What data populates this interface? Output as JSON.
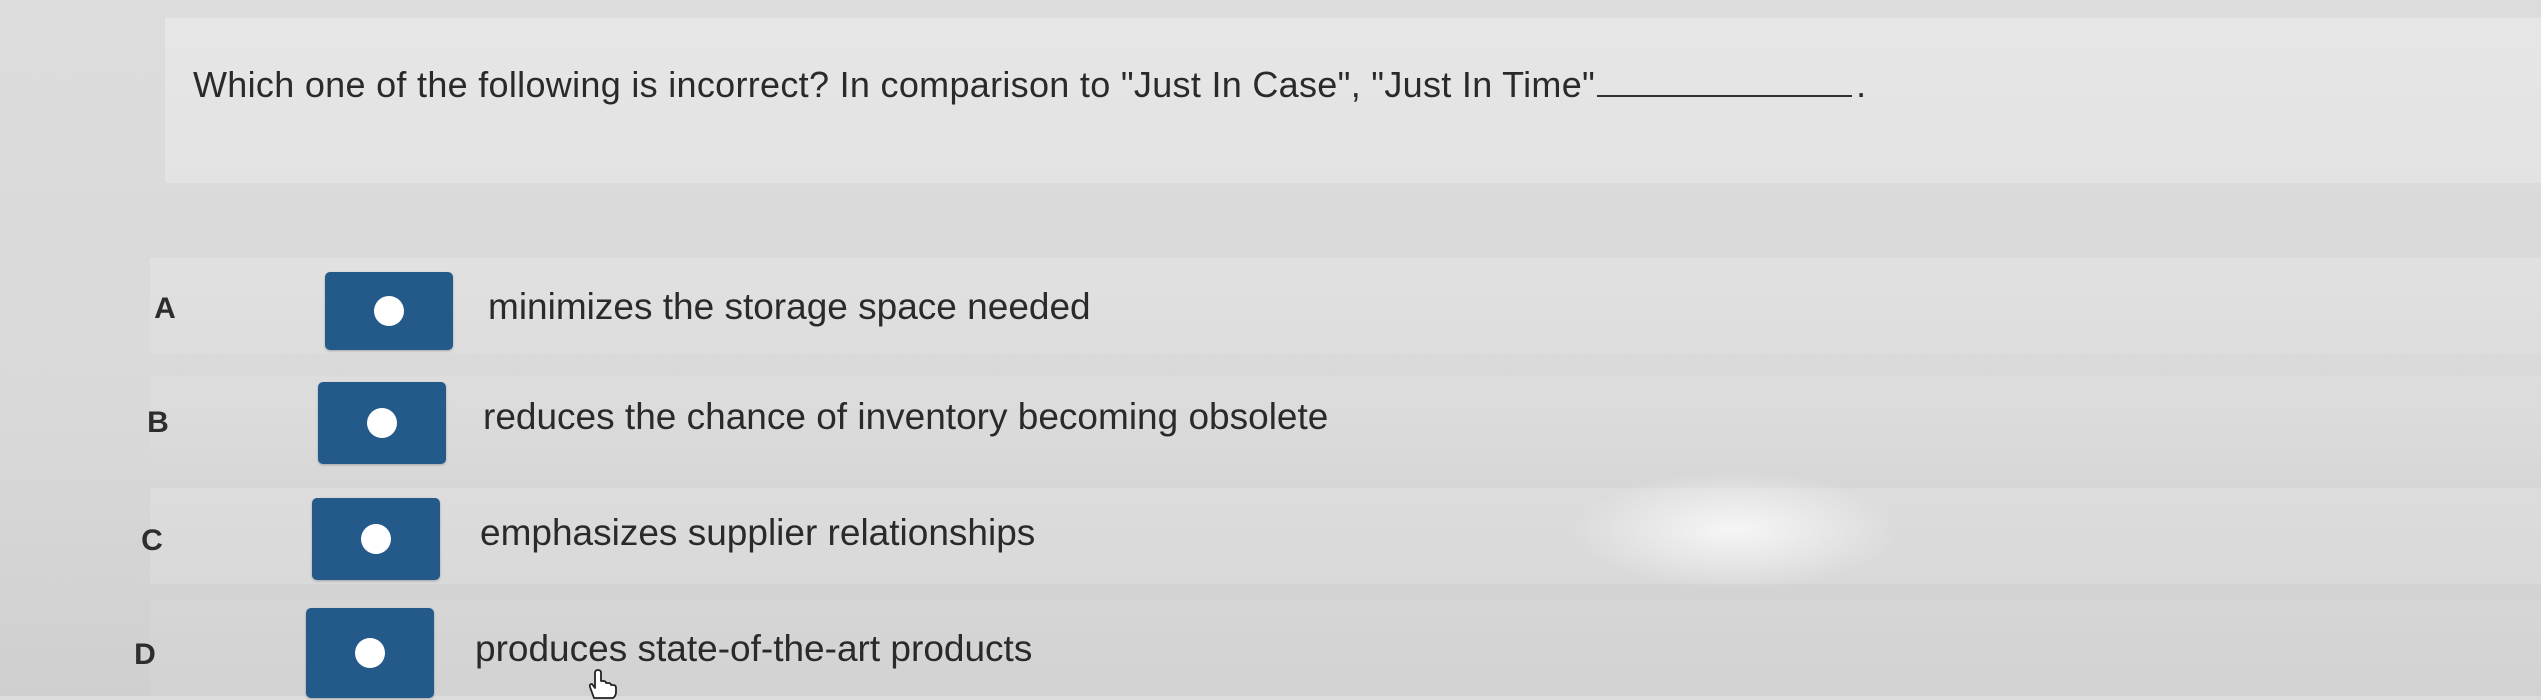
{
  "question": {
    "text": "Which one of the following is incorrect? In comparison to \"Just In Case\", \"Just In Time\"",
    "period": "."
  },
  "choices": [
    {
      "letter": "A",
      "text": "minimizes the storage space needed"
    },
    {
      "letter": "B",
      "text": "reduces the chance of inventory becoming obsolete"
    },
    {
      "letter": "C",
      "text": "emphasizes supplier relationships"
    },
    {
      "letter": "D",
      "text": "produces state-of-the-art products"
    }
  ],
  "colors": {
    "radio_button_fill": "#245a8a",
    "radio_dot": "#ffffff"
  },
  "icons": {
    "cursor": "hand-pointer-icon",
    "radio": "radio-circle-icon"
  }
}
